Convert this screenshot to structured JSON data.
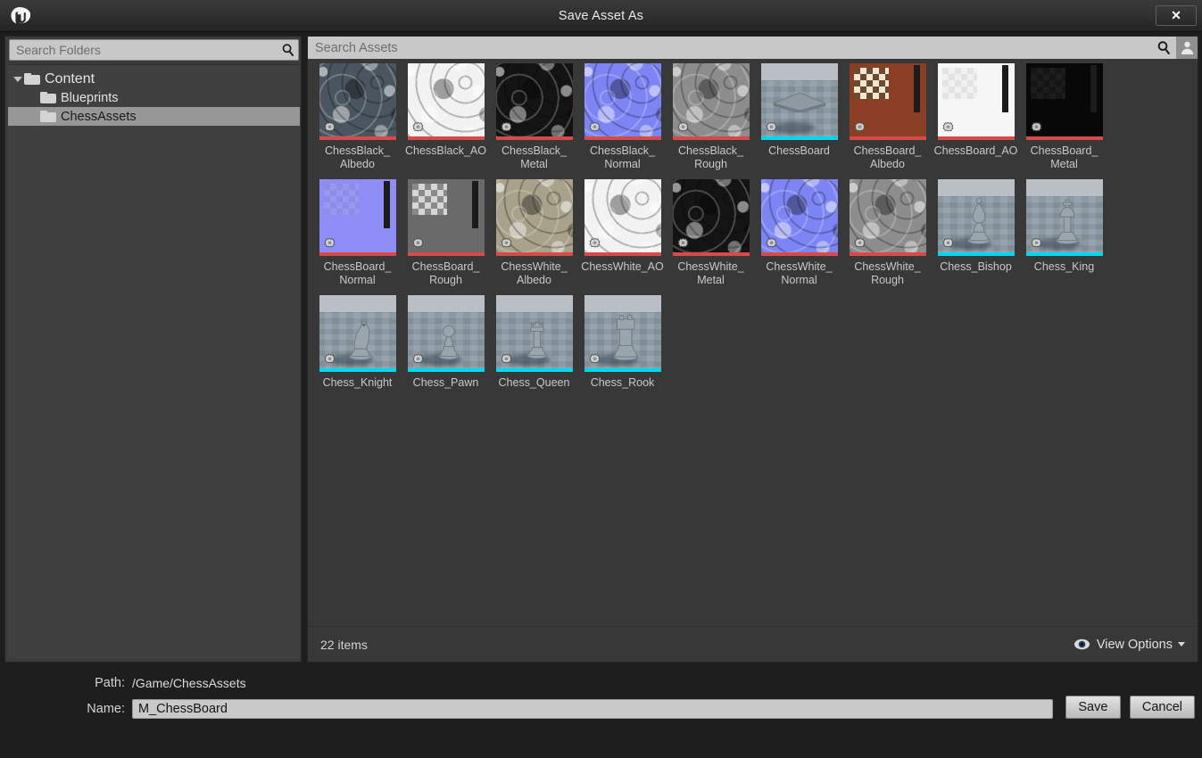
{
  "window": {
    "title": "Save Asset As",
    "logo_glyph": "U",
    "close_label": "✕"
  },
  "folder_panel": {
    "search_placeholder": "Search Folders",
    "tree": [
      {
        "label": "Content",
        "depth": 0,
        "expanded": true,
        "selected": false
      },
      {
        "label": "Blueprints",
        "depth": 1,
        "expanded": false,
        "selected": false
      },
      {
        "label": "ChessAssets",
        "depth": 1,
        "expanded": false,
        "selected": true
      }
    ]
  },
  "asset_panel": {
    "search_placeholder": "Search Assets",
    "status": {
      "item_count": "22 items",
      "view_options_label": "View Options"
    },
    "type_colors": {
      "texture": "#d64a4a",
      "static_mesh": "#00d8f0"
    },
    "assets": [
      {
        "label": "ChessBlack_\nAlbedo",
        "type": "texture",
        "thumb": "swirl",
        "base": "bg-albedo-black"
      },
      {
        "label": "ChessBlack_AO",
        "type": "texture",
        "thumb": "swirl",
        "base": "bg-ao-white"
      },
      {
        "label": "ChessBlack_\nMetal",
        "type": "texture",
        "thumb": "swirl",
        "base": "bg-metal"
      },
      {
        "label": "ChessBlack_\nNormal",
        "type": "texture",
        "thumb": "swirl",
        "base": "bg-normal"
      },
      {
        "label": "ChessBlack_\nRough",
        "type": "texture",
        "thumb": "swirl",
        "base": "bg-rough"
      },
      {
        "label": "ChessBoard",
        "type": "static_mesh",
        "thumb": "viewport",
        "base": "",
        "piece": "board"
      },
      {
        "label": "ChessBoard_\nAlbedo",
        "type": "texture",
        "thumb": "board",
        "base": "bg-board-albedo"
      },
      {
        "label": "ChessBoard_AO",
        "type": "texture",
        "thumb": "board",
        "base": "bg-board-ao"
      },
      {
        "label": "ChessBoard_\nMetal",
        "type": "texture",
        "thumb": "board",
        "base": "bg-board-metal"
      },
      {
        "label": "ChessBoard_\nNormal",
        "type": "texture",
        "thumb": "board",
        "base": "bg-board-normal"
      },
      {
        "label": "ChessBoard_\nRough",
        "type": "texture",
        "thumb": "board",
        "base": "bg-board-rough"
      },
      {
        "label": "ChessWhite_\nAlbedo",
        "type": "texture",
        "thumb": "swirl",
        "base": "bg-albedo-white"
      },
      {
        "label": "ChessWhite_AO",
        "type": "texture",
        "thumb": "swirl",
        "base": "bg-ao-white"
      },
      {
        "label": "ChessWhite_\nMetal",
        "type": "texture",
        "thumb": "swirl",
        "base": "bg-metal"
      },
      {
        "label": "ChessWhite_\nNormal",
        "type": "texture",
        "thumb": "swirl",
        "base": "bg-normal"
      },
      {
        "label": "ChessWhite_\nRough",
        "type": "texture",
        "thumb": "swirl",
        "base": "bg-rough"
      },
      {
        "label": "Chess_Bishop",
        "type": "static_mesh",
        "thumb": "viewport",
        "base": "",
        "piece": "bishop"
      },
      {
        "label": "Chess_King",
        "type": "static_mesh",
        "thumb": "viewport",
        "base": "",
        "piece": "king"
      },
      {
        "label": "Chess_Knight",
        "type": "static_mesh",
        "thumb": "viewport",
        "base": "",
        "piece": "knight"
      },
      {
        "label": "Chess_Pawn",
        "type": "static_mesh",
        "thumb": "viewport",
        "base": "",
        "piece": "pawn"
      },
      {
        "label": "Chess_Queen",
        "type": "static_mesh",
        "thumb": "viewport",
        "base": "",
        "piece": "queen"
      },
      {
        "label": "Chess_Rook",
        "type": "static_mesh",
        "thumb": "viewport",
        "base": "",
        "piece": "rook"
      }
    ]
  },
  "form": {
    "path_label": "Path:",
    "path_value": "/Game/ChessAssets",
    "name_label": "Name:",
    "name_value": "M_ChessBoard",
    "save_label": "Save",
    "cancel_label": "Cancel"
  }
}
